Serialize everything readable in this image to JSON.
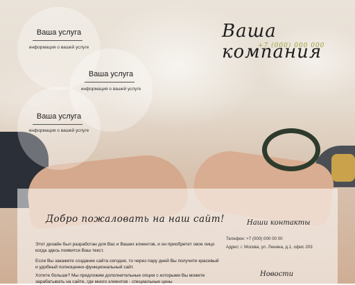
{
  "company": {
    "name": "Ваша компания",
    "phone": "+7 (000) 000 000"
  },
  "services": [
    {
      "title": "Ваша услуга",
      "desc": "информация о вашей услуге"
    },
    {
      "title": "Ваша услуга",
      "desc": "информация о вашей услуге"
    },
    {
      "title": "Ваша услуга",
      "desc": "информация о вашей услуге"
    }
  ],
  "welcome": {
    "heading": "Добро пожаловать на наш сайт!",
    "paragraphs": [
      "Этот дизайн был разработан для Вас и Ваших клиентов, и он приобретет свое лицо когда здесь появится Ваш текст.",
      "Если Вы закажете создание сайта сегодня, то через пару дней Вы получите красивый и удобный полноценно-функциональный сайт.",
      "Хотите больше? Мы предложим дополнительные опции с которыми Вы можете зарабатывать на сайте, где много клиентов - специальные цены"
    ]
  },
  "contacts": {
    "title": "Наши контакты",
    "phone_line": "Телефон: +7 (000) 000 00 00",
    "address_line": "Адрес: г. Москва, ул. Ленина, д.1, офис 203"
  },
  "news": {
    "title": "Новости"
  }
}
